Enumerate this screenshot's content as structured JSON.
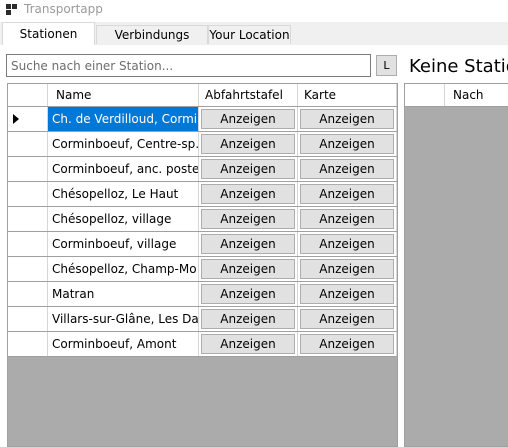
{
  "window": {
    "title": "Transportapp"
  },
  "tabs": [
    {
      "label": "Stationen Suche",
      "active": true
    },
    {
      "label": "Verbindungs Suche",
      "active": false
    },
    {
      "label": "Your Location",
      "active": false
    }
  ],
  "search": {
    "placeholder": "Suche nach einer Station...",
    "value": "",
    "button_label": "L"
  },
  "detail": {
    "heading": "Keine Station",
    "columns": [
      "Nach"
    ]
  },
  "stations_grid": {
    "columns": [
      "Name",
      "Abfahrtstafel",
      "Karte"
    ],
    "button_label": "Anzeigen",
    "rows": [
      {
        "name": "Ch. de Verdilloud, Cormi…",
        "selected": true
      },
      {
        "name": "Corminboeuf, Centre-sp…",
        "selected": false
      },
      {
        "name": "Corminboeuf, anc. poste",
        "selected": false
      },
      {
        "name": "Chésopelloz, Le Haut",
        "selected": false
      },
      {
        "name": "Chésopelloz, village",
        "selected": false
      },
      {
        "name": "Corminboeuf, village",
        "selected": false
      },
      {
        "name": "Chésopelloz, Champ-Mo…",
        "selected": false
      },
      {
        "name": "Matran",
        "selected": false
      },
      {
        "name": "Villars-sur-Glâne, Les Dail…",
        "selected": false
      },
      {
        "name": "Corminboeuf, Amont",
        "selected": false
      }
    ]
  },
  "colors": {
    "selection": "#0078d7",
    "grid_background": "#ababab",
    "button_face": "#e1e1e1"
  },
  "icons": {
    "app": "app-window-icon",
    "current_row": "row-pointer-icon"
  }
}
